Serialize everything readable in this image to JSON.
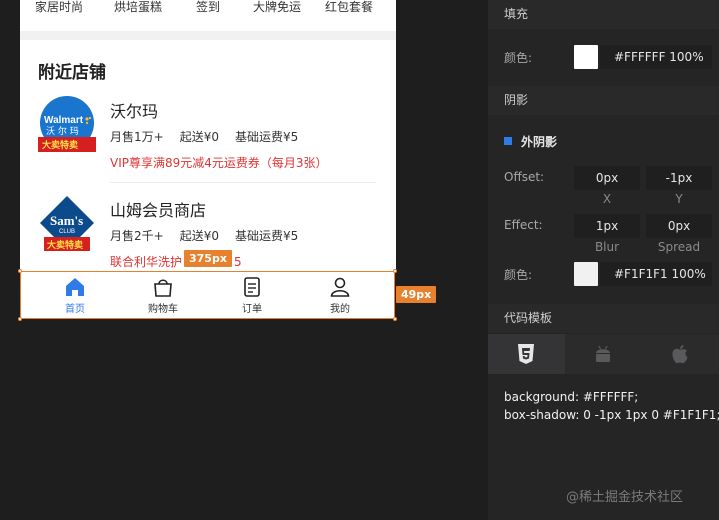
{
  "categories": [
    "家居时尚",
    "烘培蛋糕",
    "签到",
    "大牌免运",
    "红包套餐"
  ],
  "nearby": {
    "title": "附近店铺",
    "stores": [
      {
        "name": "沃尔玛",
        "sales": "月售1万+",
        "min_order": "起送¥0",
        "delivery": "基础运费¥5",
        "promo": "VIP尊享满89元减4元运费券（每月3张）",
        "logo_text": [
          "Walmart",
          "沃尔玛",
          "大卖特卖"
        ]
      },
      {
        "name": "山姆会员商店",
        "sales": "月售2千+",
        "min_order": "起送¥0",
        "delivery": "基础运费¥5",
        "promo": "联合利华洗护",
        "promo_tail": "5",
        "logo_text": [
          "Sam's",
          "CLUB",
          "大卖特卖"
        ]
      }
    ]
  },
  "tabbar": {
    "items": [
      {
        "label": "首页",
        "icon": "home-icon",
        "active": true
      },
      {
        "label": "购物车",
        "icon": "shopping-bag-icon",
        "active": false
      },
      {
        "label": "订单",
        "icon": "order-list-icon",
        "active": false
      },
      {
        "label": "我的",
        "icon": "user-icon",
        "active": false
      }
    ],
    "width_badge": "375px",
    "height_badge": "49px"
  },
  "inspector": {
    "fill": {
      "title": "填充",
      "color_label": "颜色:",
      "color_value": "#FFFFFF 100%",
      "swatch": "#FFFFFF"
    },
    "shadow": {
      "title": "阴影",
      "type": "外阴影",
      "offset_label": "Offset:",
      "offset_x": "0px",
      "offset_y": "-1px",
      "x_label": "X",
      "y_label": "Y",
      "effect_label": "Effect:",
      "blur": "1px",
      "spread": "0px",
      "blur_label": "Blur",
      "spread_label": "Spread",
      "color_label": "颜色:",
      "color_value": "#F1F1F1 100%",
      "swatch": "#F1F1F1"
    },
    "code": {
      "title": "代码模板",
      "tabs": [
        "css3-icon",
        "android-icon",
        "apple-icon"
      ],
      "lines": [
        "background: #FFFFFF;",
        "box-shadow: 0 -1px 1px 0 #F1F1F1;"
      ]
    }
  },
  "watermark": "@稀土掘金技术社区",
  "colors": {
    "accent_orange": "#E8812D",
    "active_blue": "#2F7BE8",
    "promo_red": "#E03434"
  }
}
